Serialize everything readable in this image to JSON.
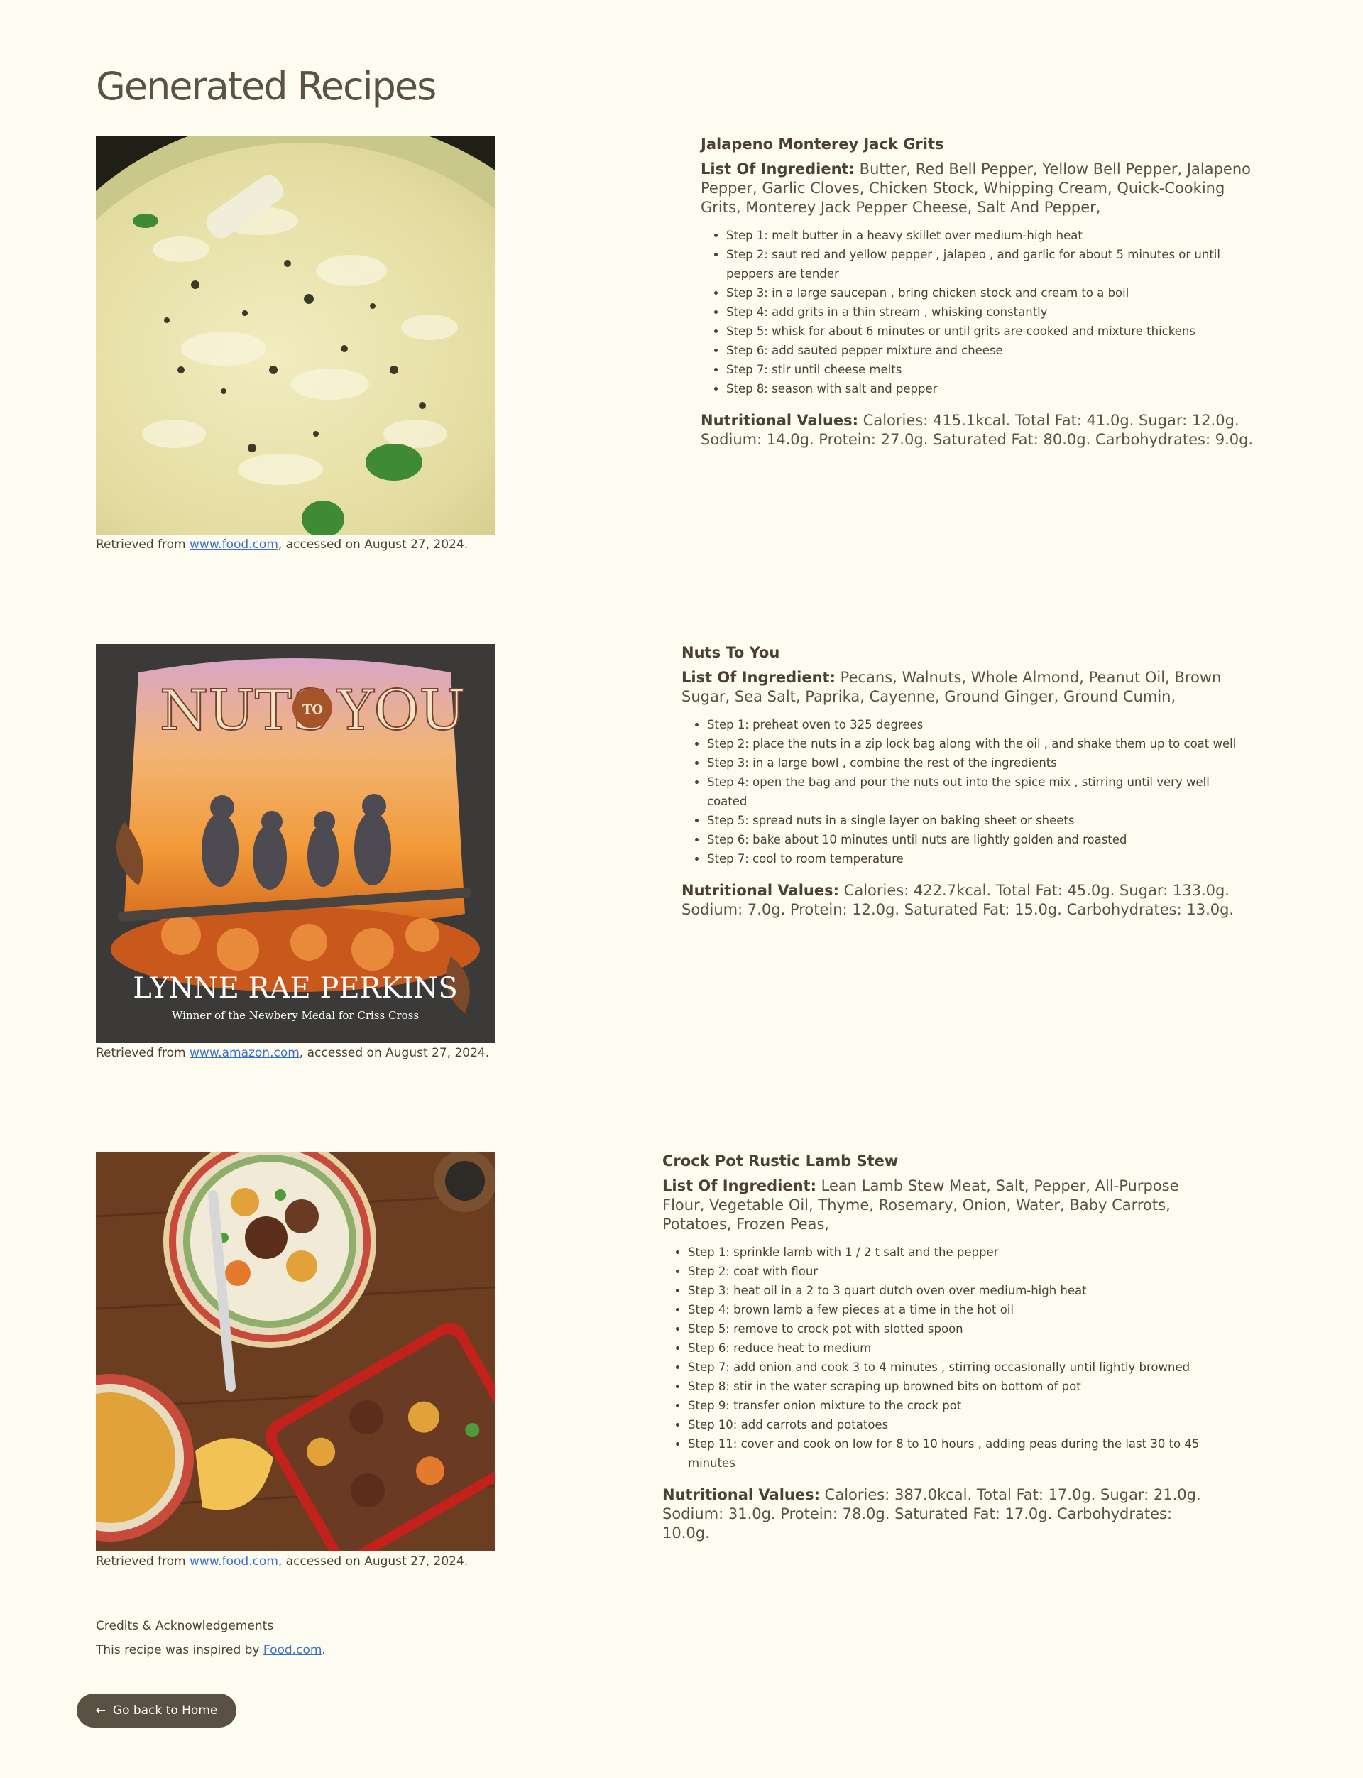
{
  "page": {
    "title": "Generated Recipes"
  },
  "recipes": [
    {
      "name": "Jalapeno Monterey Jack Grits",
      "ingredients_label": "List Of Ingredient:",
      "ingredients": "Butter, Red Bell Pepper, Yellow Bell Pepper, Jalapeno Pepper, Garlic Cloves, Chicken Stock, Whipping Cream, Quick-Cooking Grits, Monterey Jack Pepper Cheese, Salt And Pepper,",
      "steps": [
        "Step 1: melt butter in a heavy skillet over medium-high heat",
        "Step 2: saut red and yellow pepper , jalapeo , and garlic for about 5 minutes or until peppers are tender",
        "Step 3: in a large saucepan , bring chicken stock and cream to a boil",
        "Step 4: add grits in a thin stream , whisking constantly",
        "Step 5: whisk for about 6 minutes or until grits are cooked and mixture thickens",
        "Step 6: add sauted pepper mixture and cheese",
        "Step 7: stir until cheese melts",
        "Step 8: season with salt and pepper"
      ],
      "nutrition_label": "Nutritional Values:",
      "nutrition": "Calories: 415.1kcal. Total Fat: 41.0g. Sugar: 12.0g. Sodium: 14.0g. Protein: 27.0g. Saturated Fat: 80.0g. Carbohydrates: 9.0g.",
      "image_icon": "grits-photo",
      "attribution_prefix": "Retrieved from ",
      "attribution_link": "www.food.com",
      "attribution_suffix": ", accessed on August 27, 2024."
    },
    {
      "name": "Nuts To You",
      "ingredients_label": "List Of Ingredient:",
      "ingredients": "Pecans, Walnuts, Whole Almond, Peanut Oil, Brown Sugar, Sea Salt, Paprika, Cayenne, Ground Ginger, Ground Cumin,",
      "steps": [
        "Step 1: preheat oven to 325 degrees",
        "Step 2: place the nuts in a zip lock bag along with the oil , and shake them up to coat well",
        "Step 3: in a large bowl , combine the rest of the ingredients",
        "Step 4: open the bag and pour the nuts out into the spice mix , stirring until very well coated",
        "Step 5: spread nuts in a single layer on baking sheet or sheets",
        "Step 6: bake about 10 minutes until nuts are lightly golden and roasted",
        "Step 7: cool to room temperature"
      ],
      "nutrition_label": "Nutritional Values:",
      "nutrition": "Calories: 422.7kcal. Total Fat: 45.0g. Sugar: 133.0g. Sodium: 7.0g. Protein: 12.0g. Saturated Fat: 15.0g. Carbohydrates: 13.0g.",
      "image_icon": "book-cover",
      "cover_title_left": "NUTS",
      "cover_title_mid": "TO",
      "cover_title_right": "YOU",
      "cover_author": "LYNNE RAE PERKINS",
      "cover_tagline": "Winner of the Newbery Medal for Criss Cross",
      "attribution_prefix": "Retrieved from ",
      "attribution_link": "www.amazon.com",
      "attribution_suffix": ", accessed on August 27, 2024."
    },
    {
      "name": "Crock Pot Rustic Lamb Stew",
      "ingredients_label": "List Of Ingredient:",
      "ingredients": "Lean Lamb Stew Meat, Salt, Pepper, All-Purpose Flour, Vegetable Oil, Thyme, Rosemary, Onion, Water, Baby Carrots, Potatoes, Frozen Peas,",
      "steps": [
        "Step 1: sprinkle lamb with 1 / 2 t salt and the pepper",
        "Step 2: coat with flour",
        "Step 3: heat oil in a 2 to 3 quart dutch oven over medium-high heat",
        "Step 4: brown lamb a few pieces at a time in the hot oil",
        "Step 5: remove to crock pot with slotted spoon",
        "Step 6: reduce heat to medium",
        "Step 7: add onion and cook 3 to 4 minutes , stirring occasionally until lightly browned",
        "Step 8: stir in the water scraping up browned bits on bottom of pot",
        "Step 9: transfer onion mixture to the crock pot",
        "Step 10: add carrots and potatoes",
        "Step 11: cover and cook on low for 8 to 10 hours , adding peas during the last 30 to 45 minutes"
      ],
      "nutrition_label": "Nutritional Values:",
      "nutrition": "Calories: 387.0kcal. Total Fat: 17.0g. Sugar: 21.0g. Sodium: 31.0g. Protein: 78.0g. Saturated Fat: 17.0g. Carbohydrates: 10.0g.",
      "image_icon": "stew-photo",
      "attribution_prefix": "Retrieved from ",
      "attribution_link": "www.food.com",
      "attribution_suffix": ", accessed on August 27, 2024."
    }
  ],
  "credits": {
    "title": "Credits & Acknowledgements",
    "text_prefix": "This recipe was inspired by ",
    "link": "Food.com",
    "text_suffix": "."
  },
  "home_button": {
    "icon": "arrow-left-icon",
    "arrow": "←",
    "label": "Go back to Home"
  },
  "colors": {
    "background": "#fefcf0",
    "text": "#4a4035",
    "link": "#3a6fcf",
    "button": "#5b5044"
  }
}
